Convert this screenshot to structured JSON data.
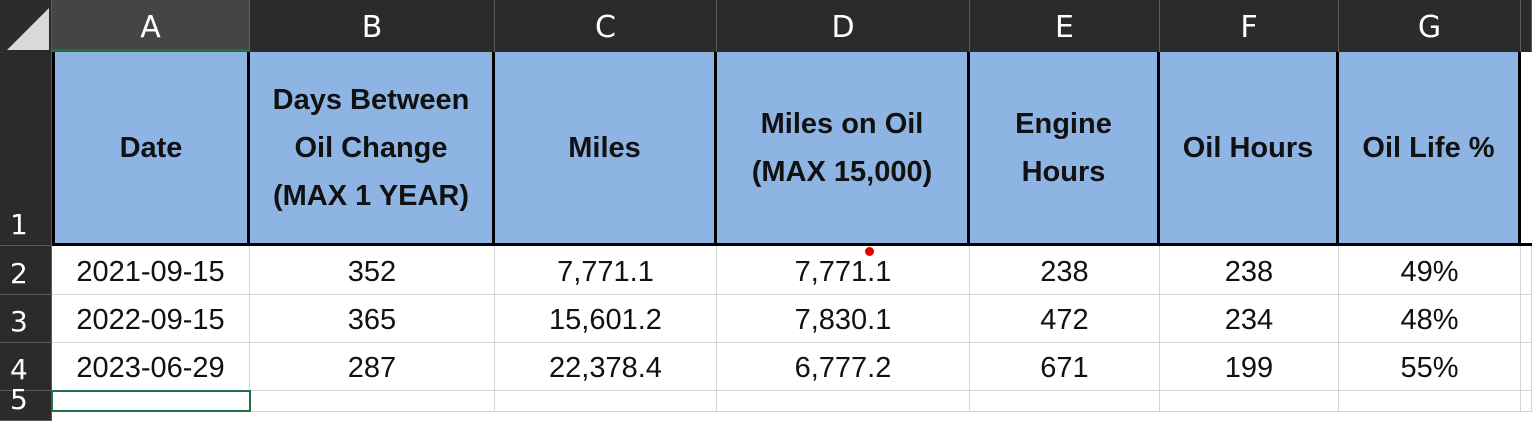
{
  "columns": [
    "A",
    "B",
    "C",
    "D",
    "E",
    "F",
    "G"
  ],
  "rows": [
    "1",
    "2",
    "3",
    "4",
    "5"
  ],
  "headers": [
    "Date",
    "Days Between Oil Change (MAX 1 YEAR)",
    "Miles",
    "Miles on Oil (MAX 15,000)",
    "Engine Hours",
    "Oil Hours",
    "Oil Life %"
  ],
  "data": [
    [
      "2021-09-15",
      "352",
      "7,771.1",
      "7,771.1",
      "238",
      "238",
      "49%"
    ],
    [
      "2022-09-15",
      "365",
      "15,601.2",
      "7,830.1",
      "472",
      "234",
      "48%"
    ],
    [
      "2023-06-29",
      "287",
      "22,378.4",
      "6,777.2",
      "671",
      "199",
      "55%"
    ]
  ],
  "colors": {
    "header_fill": "#8db4e2",
    "frame_bg": "#2b2b2b",
    "selection": "#1e7145",
    "comment_marker": "#e00000"
  }
}
